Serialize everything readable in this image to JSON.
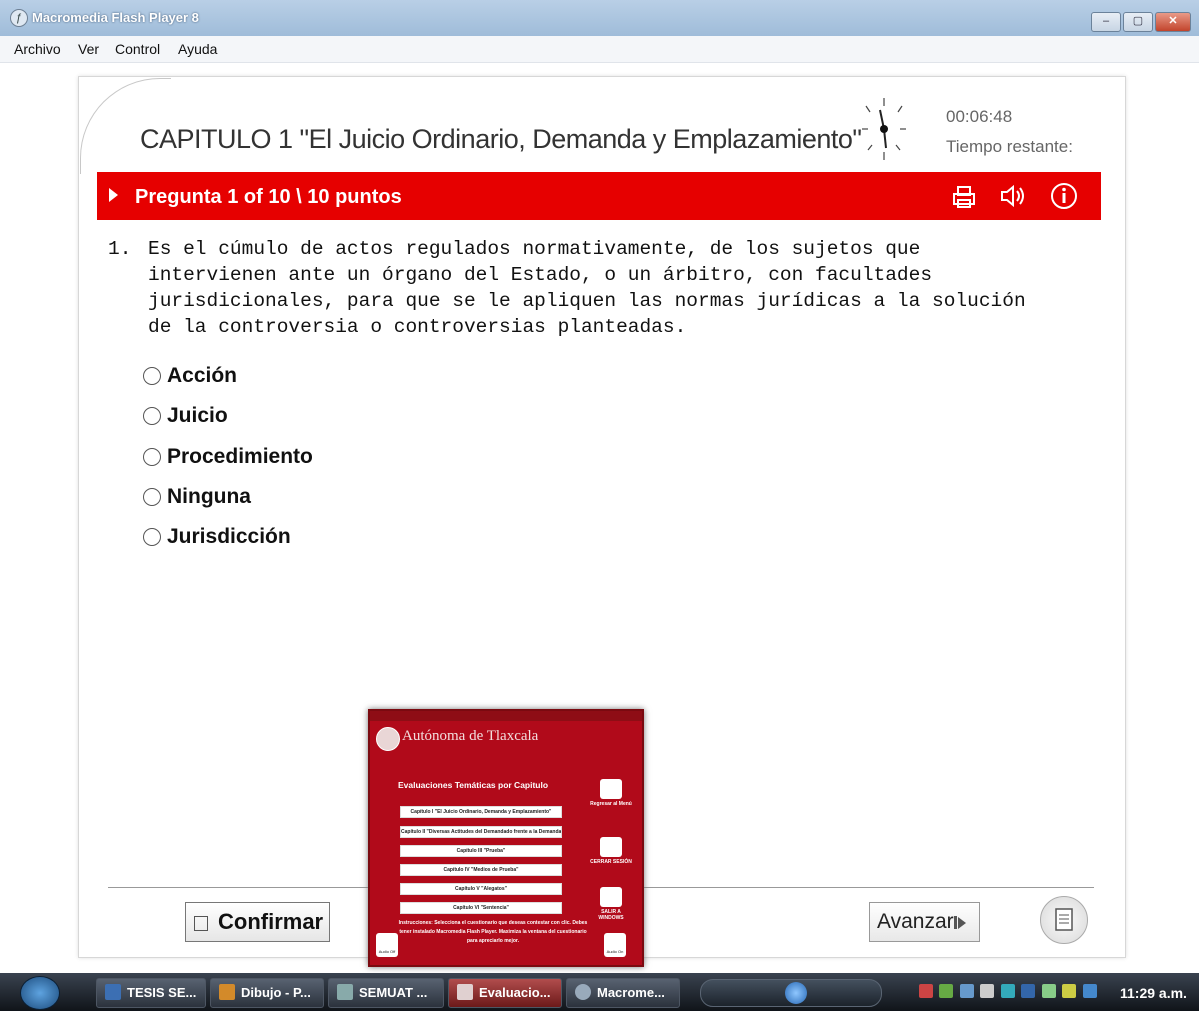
{
  "window": {
    "title": "Macromedia Flash Player 8",
    "menu": [
      "Archivo",
      "Ver",
      "Control",
      "Ayuda"
    ]
  },
  "quiz": {
    "title": "CAPITULO 1 \"El Juicio Ordinario, Demanda y Emplazamiento\"",
    "time_remaining_value": "00:06:48",
    "time_remaining_label": "Tiempo restante:",
    "question_header": "Pregunta 1 of 10 \\ 10 puntos",
    "question_number": "1.",
    "question_text": "Es el cúmulo de actos regulados normativamente, de los sujetos que intervienen ante un órgano del Estado, o un árbitro, con facultades jurisdicionales, para que se le apliquen las normas jurídicas a la solución de la controversia o controversias planteadas.",
    "options": [
      "Acción",
      "Juicio",
      "Procedimiento",
      "Ninguna",
      "Jurisdicción"
    ],
    "confirm_label": "Confirmar",
    "next_label": "Avanzar",
    "icons": [
      "print-icon",
      "audio-icon",
      "info-icon",
      "notes-icon",
      "clock-icon"
    ],
    "accent_color": "#e60000"
  },
  "popup": {
    "university": "Autónoma de Tlaxcala",
    "heading": "Evaluaciones Temáticas por Capitulo",
    "chapters": [
      "Capítulo I \"El Juicio Ordinario, Demanda y Emplazamiento\"",
      "Capítulo II \"Diversas Actitudes del Demandado frente a la Demanda\"",
      "Capítulo III \"Prueba\"",
      "Capítulo IV \"Medios de Prueba\"",
      "Capítulo V \"Alegatos\"",
      "Capítulo VI \"Sentencia\""
    ],
    "side_buttons": [
      "Regresar al Menú",
      "CERRAR SESIÓN",
      "SALIR A WINDOWS"
    ],
    "instructions": "Instrucciones: Selecciona el cuestionario que deseas contestar con clic. Debes tener instalado Macromedia Flash Player. Maximiza la ventana del cuestionario para apreciarlo mejor.",
    "audio_off": "Audio Off",
    "audio_on": "Audio On"
  },
  "taskbar": {
    "tasks": [
      "TESIS SE...",
      "Dibujo - P...",
      "SEMUAT ...",
      "Evaluacio...",
      "Macrome..."
    ],
    "clock": "11:29 a.m."
  }
}
